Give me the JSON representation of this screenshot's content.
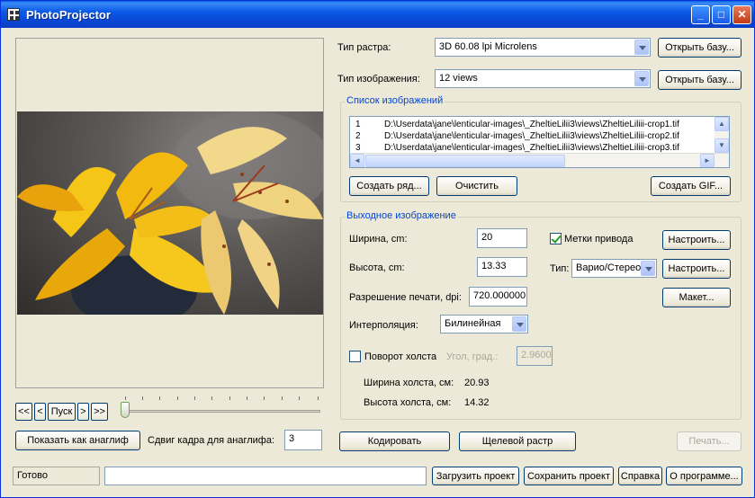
{
  "window": {
    "title": "PhotoProjector",
    "minimize": "_",
    "maximize": "□",
    "close": "✕"
  },
  "raster": {
    "type_label": "Тип растра:",
    "type_value": "3D 60.08 lpi Microlens",
    "open_db_label": "Открыть базу..."
  },
  "image": {
    "type_label": "Тип изображения:",
    "type_value": "12 views",
    "open_db_label": "Открыть базу..."
  },
  "image_list": {
    "group_title": "Список изображений",
    "rows": [
      {
        "num": "1",
        "path": "D:\\Userdata\\jane\\lenticular-images\\_ZheltieLilii3\\views\\ZheltieLiliii-crop1.tif"
      },
      {
        "num": "2",
        "path": "D:\\Userdata\\jane\\lenticular-images\\_ZheltieLilii3\\views\\ZheltieLiliii-crop2.tif"
      },
      {
        "num": "3",
        "path": "D:\\Userdata\\jane\\lenticular-images\\_ZheltieLilii3\\views\\ZheltieLiliii-crop3.tif"
      }
    ],
    "create_row_label": "Создать ряд...",
    "clear_label": "Очистить",
    "create_gif_label": "Создать GIF..."
  },
  "output": {
    "group_title": "Выходное изображение",
    "width_label": "Ширина, cm:",
    "width_value": "20",
    "height_label": "Высота,  cm:",
    "height_value": "13.33",
    "dpi_label": "Разрешение печати, dpi:",
    "dpi_value": "720.000000",
    "interp_label": "Интерполяция:",
    "interp_value": "Билинейная",
    "rotate_label": "Поворот холста",
    "angle_label": "Угол, град.:",
    "angle_value": "2.9600",
    "canvas_width_label": "Ширина холста,  см:",
    "canvas_width_value": "20.93",
    "canvas_height_label": "Высота холста,  см:",
    "canvas_height_value": "14.32",
    "marks_label": "Метки привода",
    "marks_checked": true,
    "setup1_label": "Настроить...",
    "type_label": "Тип:",
    "type_value": "Варио/Стерео",
    "setup2_label": "Настроить...",
    "layout_label": "Макет..."
  },
  "playback": {
    "first": "<<",
    "prev": "<",
    "play": "Пуск",
    "next": ">",
    "last": ">>",
    "position": 0
  },
  "anaglyph": {
    "show_label": "Показать как анаглиф",
    "shift_label": "Сдвиг кадра для анаглифа:",
    "shift_value": "3"
  },
  "actions": {
    "encode_label": "Кодировать",
    "slit_label": "Щелевой растр",
    "print_label": "Печать..."
  },
  "status": {
    "text": "Готово",
    "load_label": "Загрузить проект",
    "save_label": "Сохранить проект",
    "help_label": "Справка",
    "about_label": "О программе..."
  }
}
